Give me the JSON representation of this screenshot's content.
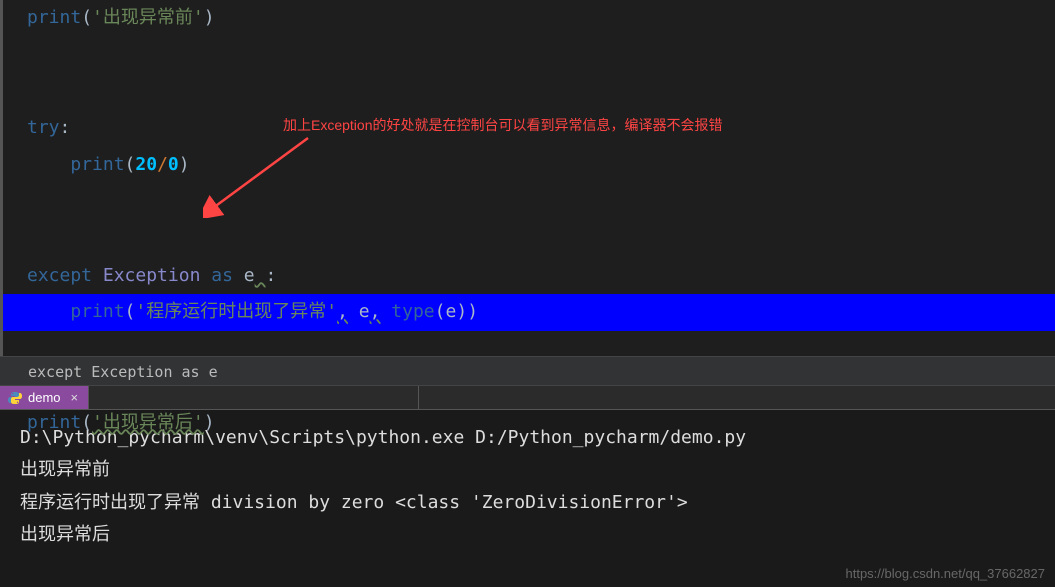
{
  "code": {
    "line1": {
      "print": "print",
      "lp": "(",
      "str": "'出现异常前'",
      "rp": ")"
    },
    "line3": {
      "try": "try",
      "colon": ":"
    },
    "line4": {
      "print": "print",
      "lp": "(",
      "num1": "20",
      "div": "/",
      "num2": "0",
      "rp": ")"
    },
    "line6": {
      "except": "except",
      "exc": "Exception",
      "as": "as",
      "var": "e",
      "space_u": " ",
      "colon": ":"
    },
    "line7": {
      "print": "print",
      "lp": "(",
      "str": "'程序运行时出现了异常'",
      "c1": ",",
      "sp1": " ",
      "e": "e",
      "c2": ",",
      "sp2": " ",
      "type": "type",
      "lp2": "(",
      "e2": "e",
      "rp2": ")",
      "rp": ")"
    },
    "line9": {
      "print": "print",
      "lp": "(",
      "str": "'出现异常后'",
      "rp": ")"
    }
  },
  "annotation": "加上Exception的好处就是在控制台可以看到异常信息，编译器不会报错",
  "breadcrumb": "except Exception as e",
  "tab": {
    "name": "demo",
    "close": "×"
  },
  "terminal": {
    "line1": "D:\\Python_pycharm\\venv\\Scripts\\python.exe D:/Python_pycharm/demo.py",
    "line2": "出现异常前",
    "line3": "程序运行时出现了异常 division by zero <class 'ZeroDivisionError'>",
    "line4": "出现异常后"
  },
  "watermark": "https://blog.csdn.net/qq_37662827"
}
